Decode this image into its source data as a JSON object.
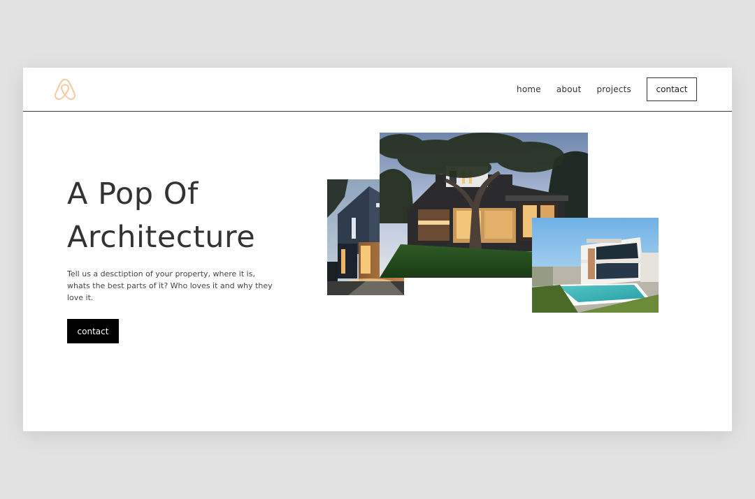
{
  "nav": {
    "logo": "brand-logo",
    "items": [
      {
        "label": "home"
      },
      {
        "label": "about"
      },
      {
        "label": "projects"
      }
    ],
    "contact_label": "contact"
  },
  "hero": {
    "title_line1": "A Pop Of",
    "title_line2": "Architecture",
    "description": "Tell us a desctiption of your property, where it is, whats the best parts of it? Who loves it and why they love it.",
    "button_label": "contact"
  },
  "colors": {
    "logo": "#f2cfa6",
    "button_bg": "#000000",
    "page_bg": "#e2e2e2"
  }
}
